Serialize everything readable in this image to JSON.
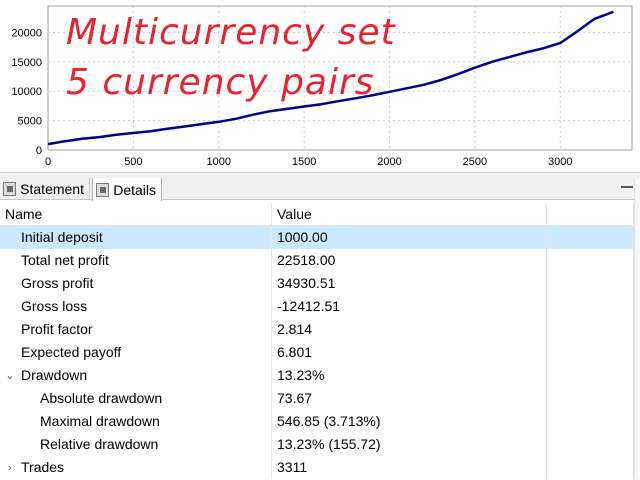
{
  "chart": {
    "annotation_line1": "Multicurrency set",
    "annotation_line2": "5 currency pairs",
    "annotation_color": "#e8232f",
    "line_color": "#00008b",
    "y_ticks": [
      "0",
      "5000",
      "10000",
      "15000",
      "20000"
    ],
    "x_ticks": [
      "0",
      "500",
      "1000",
      "1500",
      "2000",
      "2500",
      "3000"
    ]
  },
  "chart_data": {
    "type": "line",
    "title": "",
    "xlabel": "",
    "ylabel": "",
    "xlim": [
      0,
      3420
    ],
    "ylim": [
      0,
      24500
    ],
    "grid": true,
    "series": [
      {
        "x": [
          0,
          100,
          200,
          300,
          400,
          500,
          600,
          700,
          800,
          900,
          1000,
          1100,
          1200,
          1300,
          1400,
          1500,
          1600,
          1700,
          1800,
          1900,
          2000,
          2100,
          2200,
          2300,
          2400,
          2500,
          2600,
          2700,
          2800,
          2900,
          3000,
          3100,
          3200,
          3311
        ],
        "y": [
          1000,
          1500,
          1900,
          2200,
          2600,
          2900,
          3200,
          3600,
          4000,
          4400,
          4800,
          5300,
          6000,
          6600,
          7000,
          7400,
          7800,
          8300,
          8800,
          9300,
          9900,
          10500,
          11100,
          11900,
          12900,
          14000,
          15000,
          15800,
          16600,
          17300,
          18200,
          20200,
          22300,
          23518
        ]
      }
    ]
  },
  "tabs": [
    {
      "label": "Statement"
    },
    {
      "label": "Details"
    }
  ],
  "table": {
    "columns": [
      "Name",
      "Value"
    ],
    "rows": [
      {
        "name": "Initial deposit",
        "value": "1000.00"
      },
      {
        "name": "Total net profit",
        "value": "22518.00"
      },
      {
        "name": "Gross profit",
        "value": "34930.51"
      },
      {
        "name": "Gross loss",
        "value": "-12412.51"
      },
      {
        "name": "Profit factor",
        "value": "2.814"
      },
      {
        "name": "Expected payoff",
        "value": "6.801"
      },
      {
        "name": "Drawdown",
        "value": "13.23%"
      },
      {
        "name": "Absolute drawdown",
        "value": "73.67"
      },
      {
        "name": "Maximal drawdown",
        "value": "546.85 (3.713%)"
      },
      {
        "name": "Relative drawdown",
        "value": "13.23% (155.72)"
      },
      {
        "name": "Trades",
        "value": "3311"
      }
    ]
  }
}
